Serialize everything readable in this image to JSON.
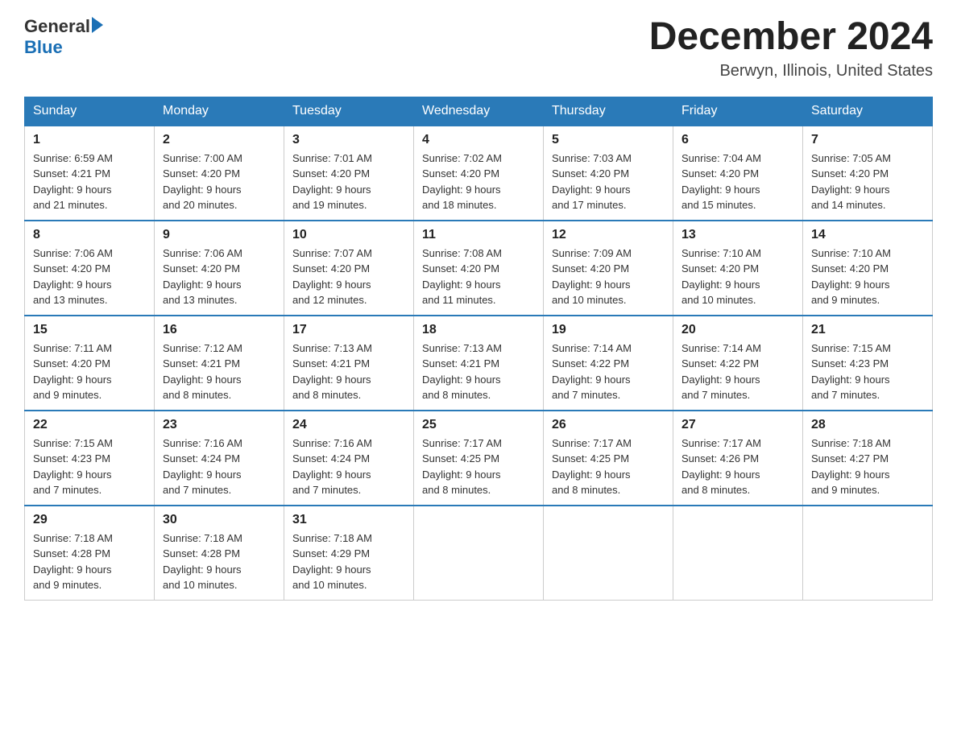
{
  "logo": {
    "general": "General",
    "blue": "Blue"
  },
  "header": {
    "month_year": "December 2024",
    "location": "Berwyn, Illinois, United States"
  },
  "days_of_week": [
    "Sunday",
    "Monday",
    "Tuesday",
    "Wednesday",
    "Thursday",
    "Friday",
    "Saturday"
  ],
  "weeks": [
    [
      {
        "day": "1",
        "sunrise": "6:59 AM",
        "sunset": "4:21 PM",
        "daylight": "9 hours and 21 minutes."
      },
      {
        "day": "2",
        "sunrise": "7:00 AM",
        "sunset": "4:20 PM",
        "daylight": "9 hours and 20 minutes."
      },
      {
        "day": "3",
        "sunrise": "7:01 AM",
        "sunset": "4:20 PM",
        "daylight": "9 hours and 19 minutes."
      },
      {
        "day": "4",
        "sunrise": "7:02 AM",
        "sunset": "4:20 PM",
        "daylight": "9 hours and 18 minutes."
      },
      {
        "day": "5",
        "sunrise": "7:03 AM",
        "sunset": "4:20 PM",
        "daylight": "9 hours and 17 minutes."
      },
      {
        "day": "6",
        "sunrise": "7:04 AM",
        "sunset": "4:20 PM",
        "daylight": "9 hours and 15 minutes."
      },
      {
        "day": "7",
        "sunrise": "7:05 AM",
        "sunset": "4:20 PM",
        "daylight": "9 hours and 14 minutes."
      }
    ],
    [
      {
        "day": "8",
        "sunrise": "7:06 AM",
        "sunset": "4:20 PM",
        "daylight": "9 hours and 13 minutes."
      },
      {
        "day": "9",
        "sunrise": "7:06 AM",
        "sunset": "4:20 PM",
        "daylight": "9 hours and 13 minutes."
      },
      {
        "day": "10",
        "sunrise": "7:07 AM",
        "sunset": "4:20 PM",
        "daylight": "9 hours and 12 minutes."
      },
      {
        "day": "11",
        "sunrise": "7:08 AM",
        "sunset": "4:20 PM",
        "daylight": "9 hours and 11 minutes."
      },
      {
        "day": "12",
        "sunrise": "7:09 AM",
        "sunset": "4:20 PM",
        "daylight": "9 hours and 10 minutes."
      },
      {
        "day": "13",
        "sunrise": "7:10 AM",
        "sunset": "4:20 PM",
        "daylight": "9 hours and 10 minutes."
      },
      {
        "day": "14",
        "sunrise": "7:10 AM",
        "sunset": "4:20 PM",
        "daylight": "9 hours and 9 minutes."
      }
    ],
    [
      {
        "day": "15",
        "sunrise": "7:11 AM",
        "sunset": "4:20 PM",
        "daylight": "9 hours and 9 minutes."
      },
      {
        "day": "16",
        "sunrise": "7:12 AM",
        "sunset": "4:21 PM",
        "daylight": "9 hours and 8 minutes."
      },
      {
        "day": "17",
        "sunrise": "7:13 AM",
        "sunset": "4:21 PM",
        "daylight": "9 hours and 8 minutes."
      },
      {
        "day": "18",
        "sunrise": "7:13 AM",
        "sunset": "4:21 PM",
        "daylight": "9 hours and 8 minutes."
      },
      {
        "day": "19",
        "sunrise": "7:14 AM",
        "sunset": "4:22 PM",
        "daylight": "9 hours and 7 minutes."
      },
      {
        "day": "20",
        "sunrise": "7:14 AM",
        "sunset": "4:22 PM",
        "daylight": "9 hours and 7 minutes."
      },
      {
        "day": "21",
        "sunrise": "7:15 AM",
        "sunset": "4:23 PM",
        "daylight": "9 hours and 7 minutes."
      }
    ],
    [
      {
        "day": "22",
        "sunrise": "7:15 AM",
        "sunset": "4:23 PM",
        "daylight": "9 hours and 7 minutes."
      },
      {
        "day": "23",
        "sunrise": "7:16 AM",
        "sunset": "4:24 PM",
        "daylight": "9 hours and 7 minutes."
      },
      {
        "day": "24",
        "sunrise": "7:16 AM",
        "sunset": "4:24 PM",
        "daylight": "9 hours and 7 minutes."
      },
      {
        "day": "25",
        "sunrise": "7:17 AM",
        "sunset": "4:25 PM",
        "daylight": "9 hours and 8 minutes."
      },
      {
        "day": "26",
        "sunrise": "7:17 AM",
        "sunset": "4:25 PM",
        "daylight": "9 hours and 8 minutes."
      },
      {
        "day": "27",
        "sunrise": "7:17 AM",
        "sunset": "4:26 PM",
        "daylight": "9 hours and 8 minutes."
      },
      {
        "day": "28",
        "sunrise": "7:18 AM",
        "sunset": "4:27 PM",
        "daylight": "9 hours and 9 minutes."
      }
    ],
    [
      {
        "day": "29",
        "sunrise": "7:18 AM",
        "sunset": "4:28 PM",
        "daylight": "9 hours and 9 minutes."
      },
      {
        "day": "30",
        "sunrise": "7:18 AM",
        "sunset": "4:28 PM",
        "daylight": "9 hours and 10 minutes."
      },
      {
        "day": "31",
        "sunrise": "7:18 AM",
        "sunset": "4:29 PM",
        "daylight": "9 hours and 10 minutes."
      },
      null,
      null,
      null,
      null
    ]
  ]
}
